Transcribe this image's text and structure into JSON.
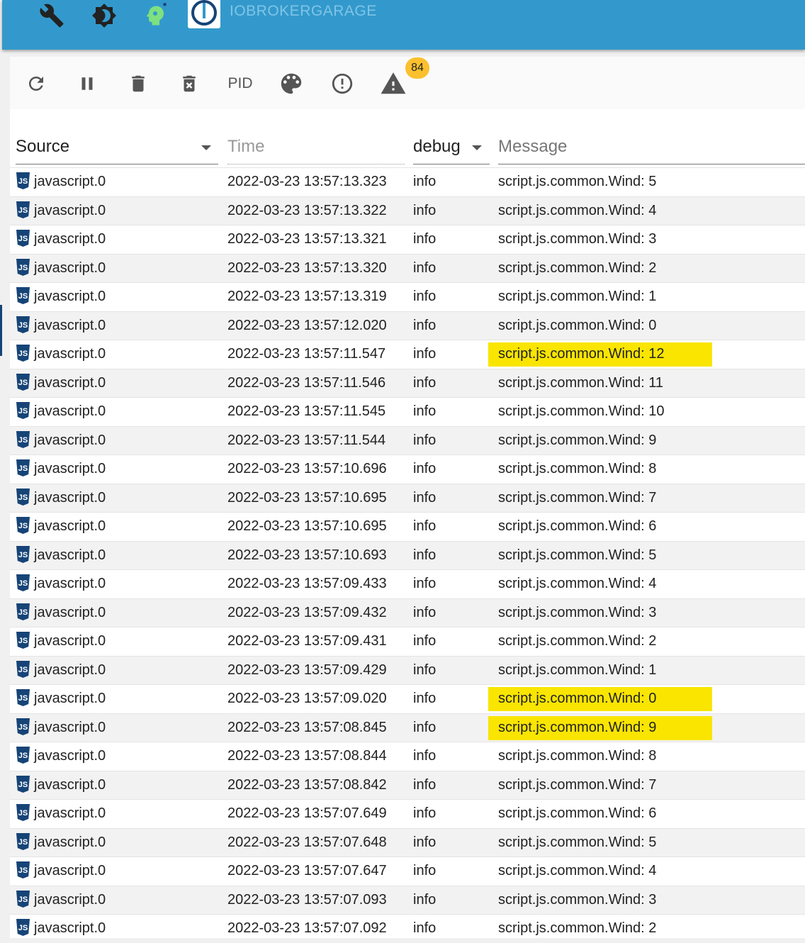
{
  "app": {
    "title": "IOBROKERGARAGE",
    "accent": "#3399cc"
  },
  "toolbar": {
    "pid_label": "PID",
    "warning_count": "84"
  },
  "columns": {
    "source": "Source",
    "time": "Time",
    "severity": "debug",
    "message": "Message"
  },
  "rows": [
    {
      "source": "javascript.0",
      "time": "2022-03-23 13:57:13.323",
      "severity": "info",
      "message": "script.js.common.Wind: 5",
      "highlight": false
    },
    {
      "source": "javascript.0",
      "time": "2022-03-23 13:57:13.322",
      "severity": "info",
      "message": "script.js.common.Wind: 4",
      "highlight": false
    },
    {
      "source": "javascript.0",
      "time": "2022-03-23 13:57:13.321",
      "severity": "info",
      "message": "script.js.common.Wind: 3",
      "highlight": false
    },
    {
      "source": "javascript.0",
      "time": "2022-03-23 13:57:13.320",
      "severity": "info",
      "message": "script.js.common.Wind: 2",
      "highlight": false
    },
    {
      "source": "javascript.0",
      "time": "2022-03-23 13:57:13.319",
      "severity": "info",
      "message": "script.js.common.Wind: 1",
      "highlight": false
    },
    {
      "source": "javascript.0",
      "time": "2022-03-23 13:57:12.020",
      "severity": "info",
      "message": "script.js.common.Wind: 0",
      "highlight": false
    },
    {
      "source": "javascript.0",
      "time": "2022-03-23 13:57:11.547",
      "severity": "info",
      "message": "script.js.common.Wind: 12",
      "highlight": true
    },
    {
      "source": "javascript.0",
      "time": "2022-03-23 13:57:11.546",
      "severity": "info",
      "message": "script.js.common.Wind: 11",
      "highlight": false
    },
    {
      "source": "javascript.0",
      "time": "2022-03-23 13:57:11.545",
      "severity": "info",
      "message": "script.js.common.Wind: 10",
      "highlight": false
    },
    {
      "source": "javascript.0",
      "time": "2022-03-23 13:57:11.544",
      "severity": "info",
      "message": "script.js.common.Wind: 9",
      "highlight": false
    },
    {
      "source": "javascript.0",
      "time": "2022-03-23 13:57:10.696",
      "severity": "info",
      "message": "script.js.common.Wind: 8",
      "highlight": false
    },
    {
      "source": "javascript.0",
      "time": "2022-03-23 13:57:10.695",
      "severity": "info",
      "message": "script.js.common.Wind: 7",
      "highlight": false
    },
    {
      "source": "javascript.0",
      "time": "2022-03-23 13:57:10.695",
      "severity": "info",
      "message": "script.js.common.Wind: 6",
      "highlight": false
    },
    {
      "source": "javascript.0",
      "time": "2022-03-23 13:57:10.693",
      "severity": "info",
      "message": "script.js.common.Wind: 5",
      "highlight": false
    },
    {
      "source": "javascript.0",
      "time": "2022-03-23 13:57:09.433",
      "severity": "info",
      "message": "script.js.common.Wind: 4",
      "highlight": false
    },
    {
      "source": "javascript.0",
      "time": "2022-03-23 13:57:09.432",
      "severity": "info",
      "message": "script.js.common.Wind: 3",
      "highlight": false
    },
    {
      "source": "javascript.0",
      "time": "2022-03-23 13:57:09.431",
      "severity": "info",
      "message": "script.js.common.Wind: 2",
      "highlight": false
    },
    {
      "source": "javascript.0",
      "time": "2022-03-23 13:57:09.429",
      "severity": "info",
      "message": "script.js.common.Wind: 1",
      "highlight": false
    },
    {
      "source": "javascript.0",
      "time": "2022-03-23 13:57:09.020",
      "severity": "info",
      "message": "script.js.common.Wind: 0",
      "highlight": true
    },
    {
      "source": "javascript.0",
      "time": "2022-03-23 13:57:08.845",
      "severity": "info",
      "message": "script.js.common.Wind: 9",
      "highlight": true
    },
    {
      "source": "javascript.0",
      "time": "2022-03-23 13:57:08.844",
      "severity": "info",
      "message": "script.js.common.Wind: 8",
      "highlight": false
    },
    {
      "source": "javascript.0",
      "time": "2022-03-23 13:57:08.842",
      "severity": "info",
      "message": "script.js.common.Wind: 7",
      "highlight": false
    },
    {
      "source": "javascript.0",
      "time": "2022-03-23 13:57:07.649",
      "severity": "info",
      "message": "script.js.common.Wind: 6",
      "highlight": false
    },
    {
      "source": "javascript.0",
      "time": "2022-03-23 13:57:07.648",
      "severity": "info",
      "message": "script.js.common.Wind: 5",
      "highlight": false
    },
    {
      "source": "javascript.0",
      "time": "2022-03-23 13:57:07.647",
      "severity": "info",
      "message": "script.js.common.Wind: 4",
      "highlight": false
    },
    {
      "source": "javascript.0",
      "time": "2022-03-23 13:57:07.093",
      "severity": "info",
      "message": "script.js.common.Wind: 3",
      "highlight": false
    },
    {
      "source": "javascript.0",
      "time": "2022-03-23 13:57:07.092",
      "severity": "info",
      "message": "script.js.common.Wind: 2",
      "highlight": false
    }
  ]
}
